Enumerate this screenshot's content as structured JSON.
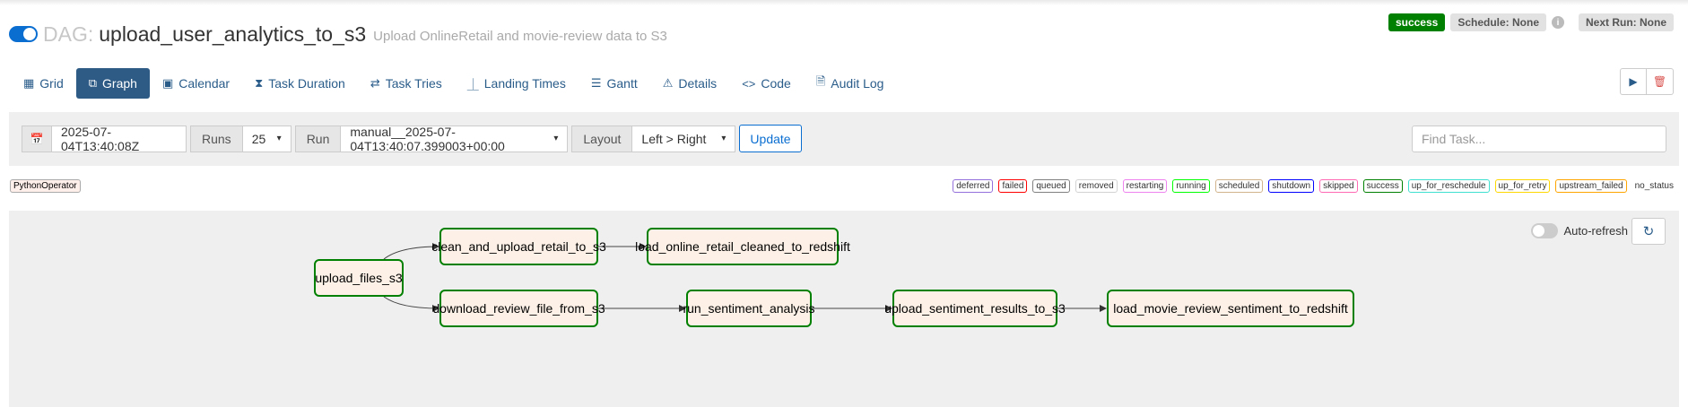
{
  "header": {
    "dag_prefix": "DAG:",
    "dag_id": "upload_user_analytics_to_s3",
    "description": "Upload OnlineRetail and movie-review data to S3",
    "status": "success",
    "schedule": "Schedule: None",
    "next_run": "Next Run: None",
    "info_glyph": "i"
  },
  "tabs": [
    {
      "label": "Grid",
      "icon": "grid-icon",
      "glyph": "▦"
    },
    {
      "label": "Graph",
      "icon": "graph-icon",
      "glyph": "⧉"
    },
    {
      "label": "Calendar",
      "icon": "calendar-icon",
      "glyph": "▣"
    },
    {
      "label": "Task Duration",
      "icon": "hourglass-icon",
      "glyph": "⧗"
    },
    {
      "label": "Task Tries",
      "icon": "retry-icon",
      "glyph": "⇄"
    },
    {
      "label": "Landing Times",
      "icon": "plane-icon",
      "glyph": "⏊"
    },
    {
      "label": "Gantt",
      "icon": "gantt-icon",
      "glyph": "☰"
    },
    {
      "label": "Details",
      "icon": "warning-icon",
      "glyph": "⚠"
    },
    {
      "label": "Code",
      "icon": "code-icon",
      "glyph": "<>"
    },
    {
      "label": "Audit Log",
      "icon": "audit-icon",
      "glyph": "🗎"
    }
  ],
  "actions": {
    "play_glyph": "▶",
    "trash_glyph": "🗑"
  },
  "filters": {
    "calendar_glyph": "📅",
    "base_date": "2025-07-04T13:40:08Z",
    "runs_label": "Runs",
    "runs_value": "25",
    "run_label": "Run",
    "run_value": "manual__2025-07-04T13:40:07.399003+00:00",
    "layout_label": "Layout",
    "layout_value": "Left > Right",
    "update_label": "Update",
    "find_task_placeholder": "Find Task...",
    "caret": "▾"
  },
  "operator_badge": "PythonOperator",
  "legend": [
    {
      "label": "deferred",
      "color": "#9370db"
    },
    {
      "label": "failed",
      "color": "#ff0000"
    },
    {
      "label": "queued",
      "color": "#808080"
    },
    {
      "label": "removed",
      "color": "#d3d3d3"
    },
    {
      "label": "restarting",
      "color": "#ee82ee"
    },
    {
      "label": "running",
      "color": "#00ff00"
    },
    {
      "label": "scheduled",
      "color": "#d2b48c"
    },
    {
      "label": "shutdown",
      "color": "#0000ff"
    },
    {
      "label": "skipped",
      "color": "#ff69b4"
    },
    {
      "label": "success",
      "color": "#008000"
    },
    {
      "label": "up_for_reschedule",
      "color": "#40e0d0"
    },
    {
      "label": "up_for_retry",
      "color": "#ffd700"
    },
    {
      "label": "upstream_failed",
      "color": "#ffa500"
    },
    {
      "label": "no_status",
      "color": ""
    }
  ],
  "graph": {
    "auto_refresh_label": "Auto-refresh",
    "refresh_glyph": "↻",
    "tasks": [
      {
        "id": "upload_files_s3",
        "state": "success"
      },
      {
        "id": "clean_and_upload_retail_to_s3",
        "state": "success"
      },
      {
        "id": "load_online_retail_cleaned_to_redshift",
        "state": "success"
      },
      {
        "id": "download_review_file_from_s3",
        "state": "success"
      },
      {
        "id": "run_sentiment_analysis",
        "state": "success"
      },
      {
        "id": "upload_sentiment_results_to_s3",
        "state": "success"
      },
      {
        "id": "load_movie_review_sentiment_to_redshift",
        "state": "success"
      }
    ]
  }
}
